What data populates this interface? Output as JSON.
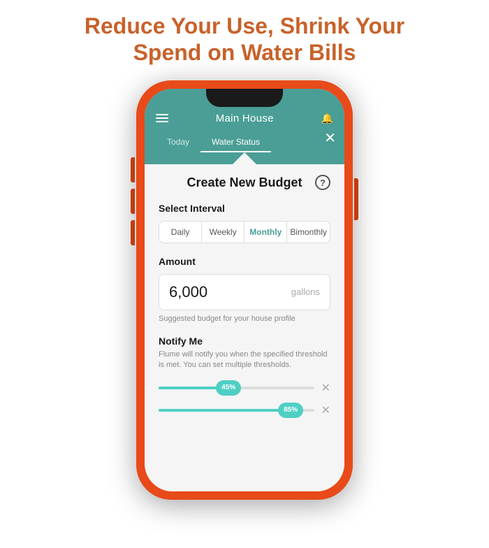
{
  "headline": {
    "line1": "Reduce Your Use, Shrink Your",
    "line2": "Spend on Water Bills"
  },
  "app": {
    "title": "Main House",
    "tabs": [
      {
        "label": "Today",
        "active": false
      },
      {
        "label": "Water Status",
        "active": true
      }
    ]
  },
  "modal": {
    "title": "Create New Budget",
    "help_icon": "?",
    "close_label": "✕",
    "interval": {
      "label": "Select Interval",
      "options": [
        {
          "label": "Daily",
          "active": false
        },
        {
          "label": "Weekly",
          "active": false
        },
        {
          "label": "Monthly",
          "active": true
        },
        {
          "label": "Bimonthly",
          "active": false
        }
      ]
    },
    "amount": {
      "label": "Amount",
      "value": "6,000",
      "unit": "gallons",
      "suggested": "Suggested budget for your house profile"
    },
    "notify": {
      "title": "Notify Me",
      "description": "Flume will notify you when the specified threshold is met. You can set multiple thresholds.",
      "thresholds": [
        {
          "percent": "45%",
          "fill": 45
        },
        {
          "percent": "85%",
          "fill": 85
        }
      ]
    }
  }
}
